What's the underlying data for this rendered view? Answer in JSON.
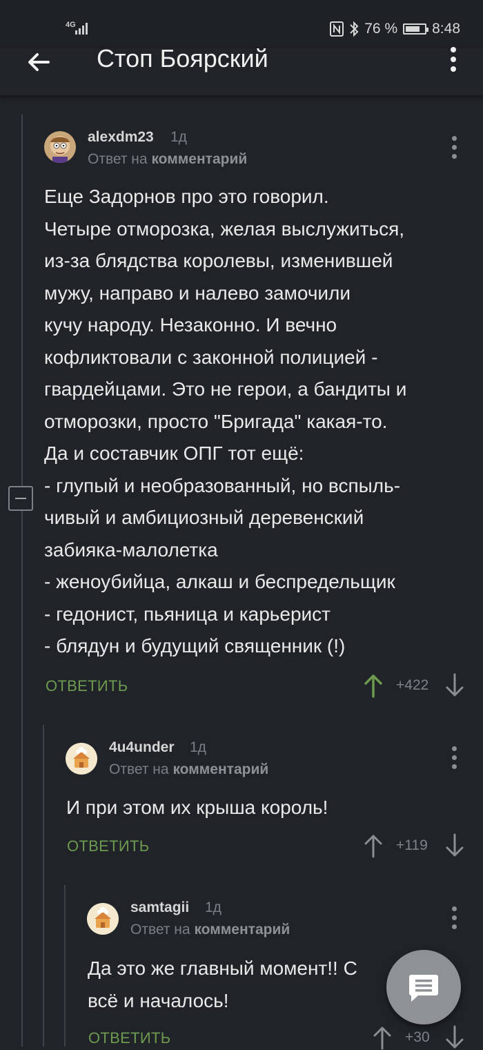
{
  "status_bar": {
    "network": "4G",
    "battery_percent": "76 %",
    "battery_level": 0.76,
    "time": "8:48",
    "icons": [
      "signal-icon",
      "nfc-icon",
      "bluetooth-icon",
      "battery-icon"
    ]
  },
  "toolbar": {
    "title": "Стоп Боярский",
    "back_icon": "arrow-left-icon",
    "menu_icon": "more-vert-icon"
  },
  "comments": [
    {
      "username": "alexdm23",
      "age": "1д",
      "reply_prefix": "Ответ на",
      "reply_target": "комментарий",
      "text": "Еще Задорнов про это говорил.\nЧетыре отморозка, желая выслужиться,\nиз-за блядства королевы, изменившей\nмужу, направо и налево замочили\nкучу народу. Незаконно. И вечно\nкофликтовали с законной полицией -\nгвардейцами. Это не герои, а бандиты и\nотморозки, просто \"Бригада\" какая-то.\nДа и составчик ОПГ тот ещё:\n- глупый и необразованный, но вспыль-\nчивый и амбициозный деревенский\nзабияка-малолетка\n- женоубийца, алкаш и беспредельщик\n- гедонист, пьяница и карьерист\n- блядун и будущий священник (!)",
      "reply_label": "ОТВЕТИТЬ",
      "score": "+422",
      "upvoted": true
    },
    {
      "username": "4u4under",
      "age": "1д",
      "reply_prefix": "Ответ на",
      "reply_target": "комментарий",
      "text": "И при этом их крыша король!",
      "reply_label": "ОТВЕТИТЬ",
      "score": "+119",
      "upvoted": false
    },
    {
      "username": "samtagii",
      "age": "1д",
      "reply_prefix": "Ответ на",
      "reply_target": "комментарий",
      "text": "Да это же главный момент!! С\nвсё и началось!",
      "reply_label": "ОТВЕТИТЬ",
      "score": "+30",
      "upvoted": false
    }
  ],
  "fab": {
    "icon": "comment-icon"
  },
  "colors": {
    "background": "#202428",
    "accent_green": "#6d9a4f",
    "muted": "#7a7f85",
    "text": "#e9e9e9",
    "fab": "#8e9296"
  }
}
